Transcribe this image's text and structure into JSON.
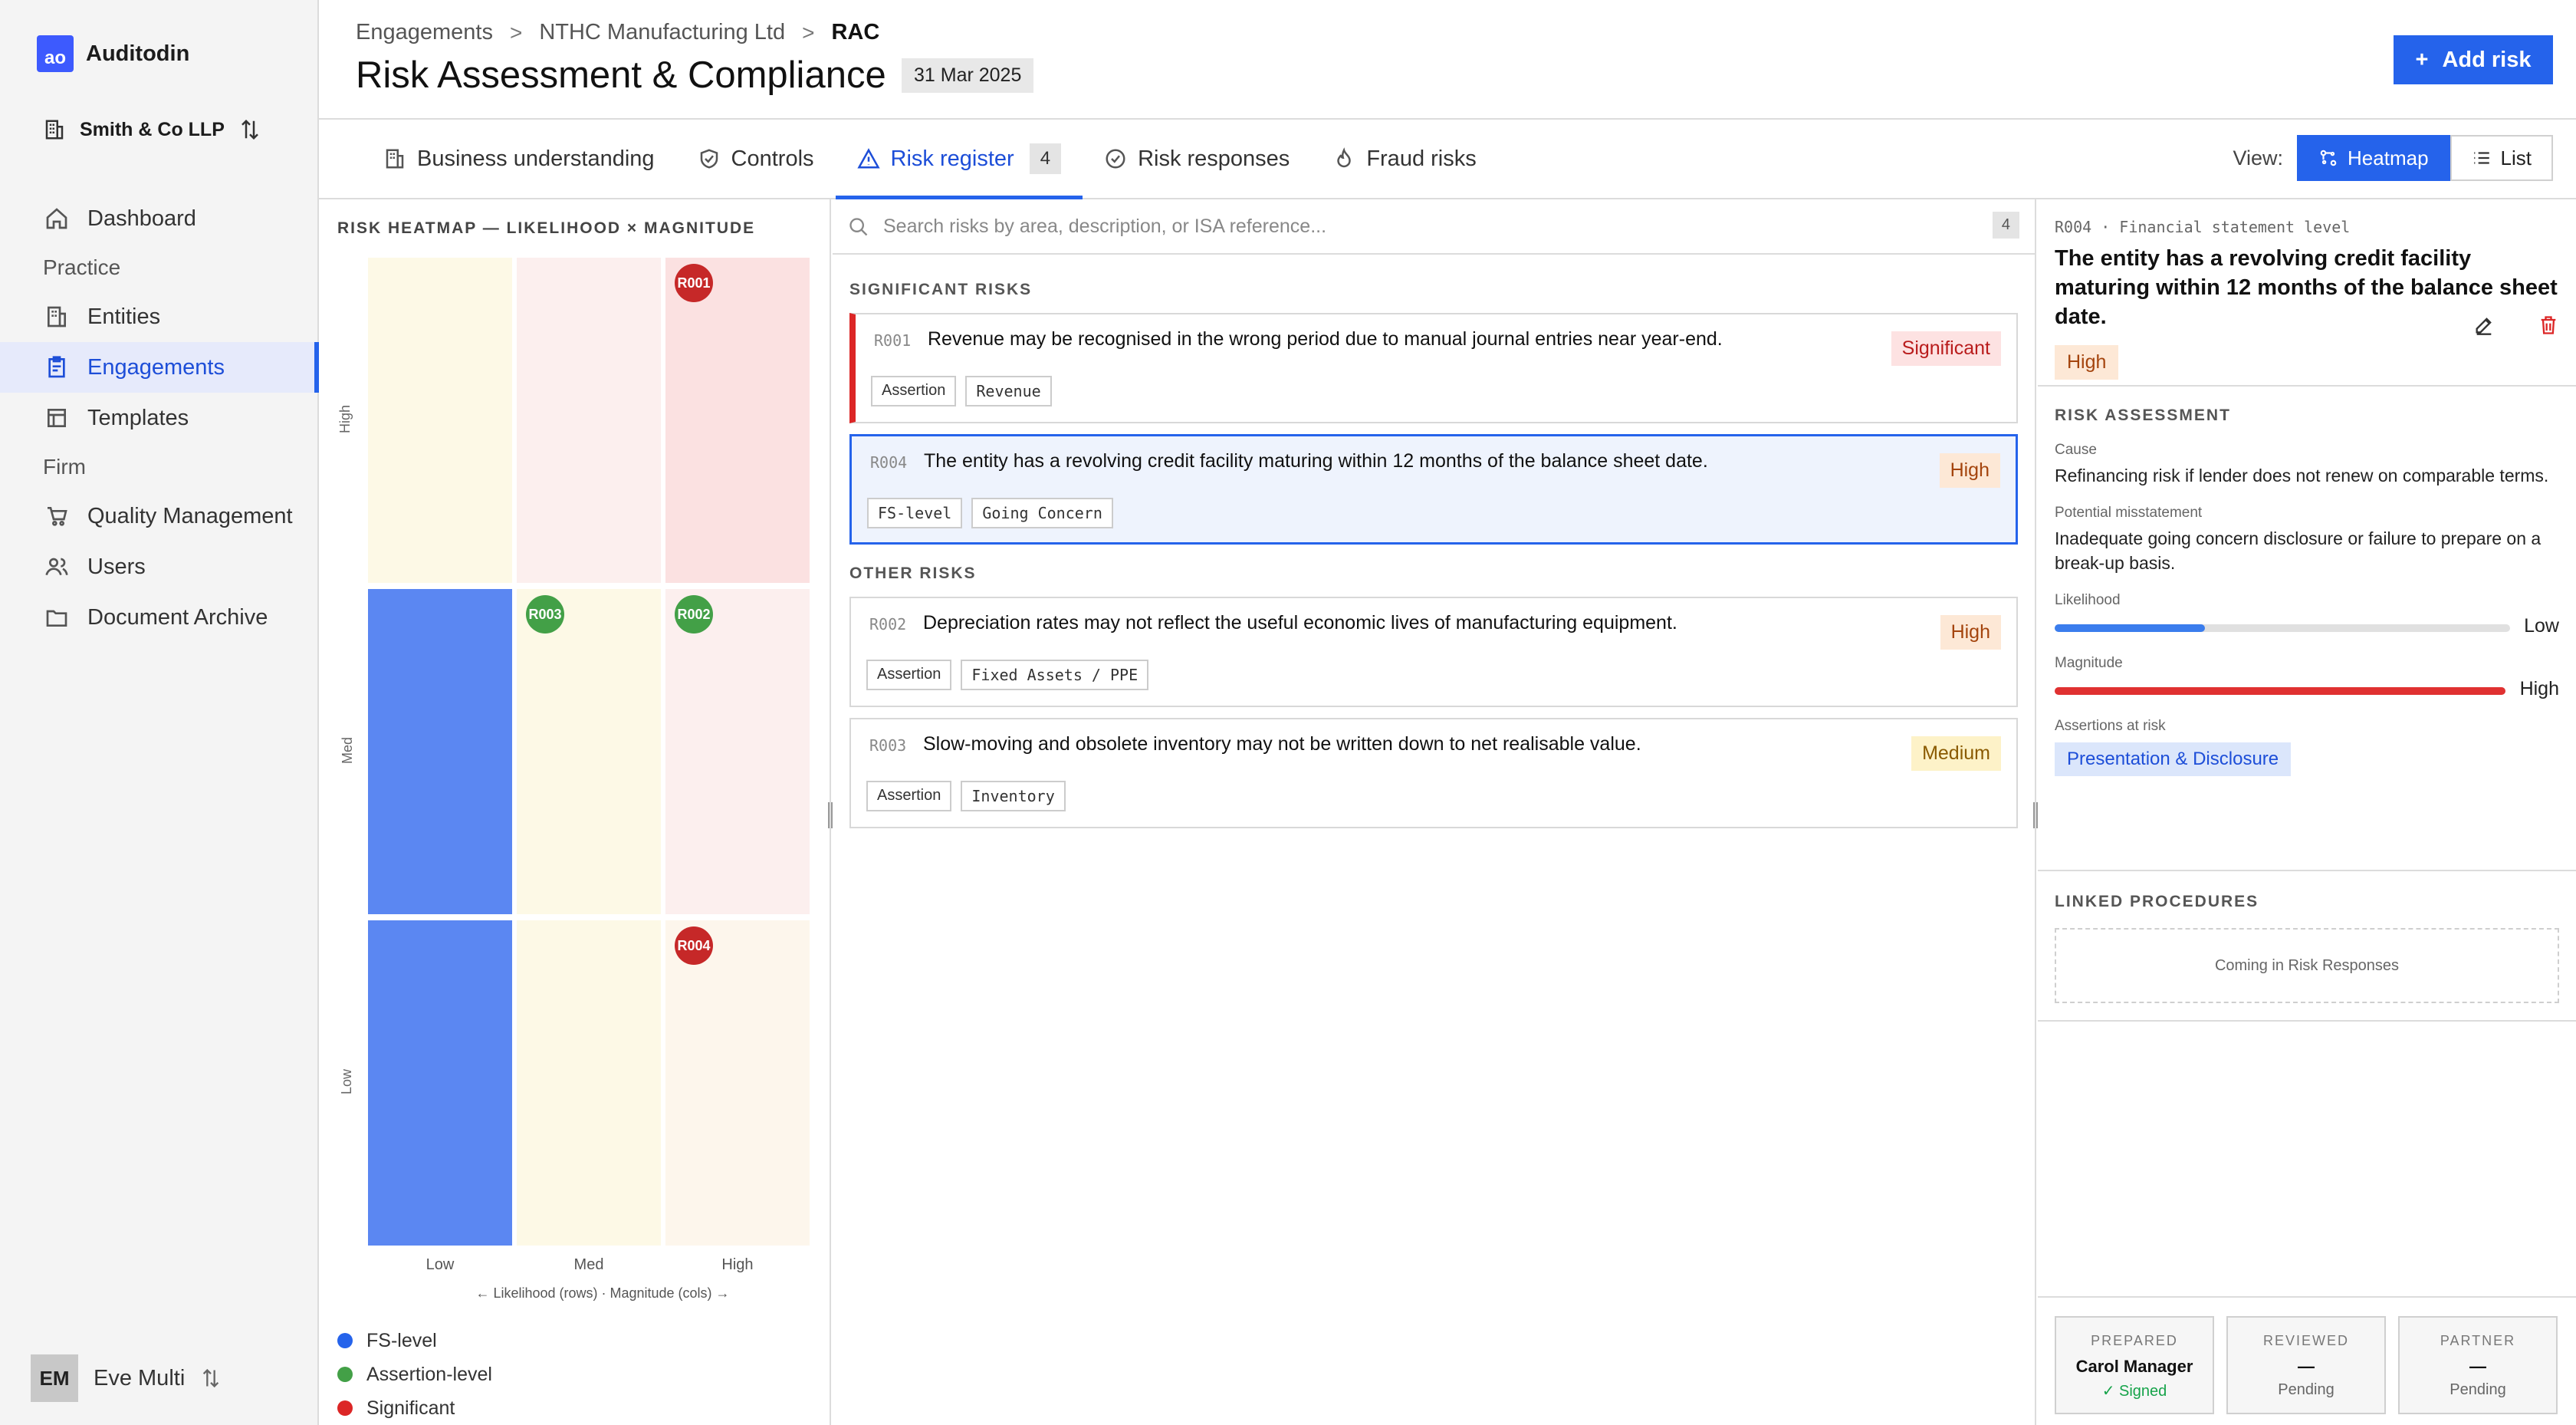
{
  "brand": {
    "name": "Auditodin",
    "logo": "ao"
  },
  "org": {
    "name": "Smith & Co LLP"
  },
  "nav": {
    "dashboard": "Dashboard",
    "practice": "Practice",
    "entities": "Entities",
    "engagements": "Engagements",
    "templates": "Templates",
    "firm": "Firm",
    "quality": "Quality Management",
    "users": "Users",
    "archive": "Document Archive"
  },
  "user": {
    "initials": "EM",
    "name": "Eve Multi"
  },
  "breadcrumb": {
    "c1": "Engagements",
    "c2": "NTHC Manufacturing Ltd",
    "c3": "RAC",
    "sep": ">"
  },
  "page": {
    "title": "Risk Assessment & Compliance",
    "date": "31 Mar 2025",
    "add_label": "Add risk"
  },
  "tabs": {
    "business": "Business understanding",
    "controls": "Controls",
    "register": "Risk register",
    "register_count": "4",
    "responses": "Risk responses",
    "fraud": "Fraud risks"
  },
  "view": {
    "label": "View:",
    "heatmap": "Heatmap",
    "list": "List"
  },
  "heatmap": {
    "title": "RISK HEATMAP — LIKELIHOOD × MAGNITUDE",
    "rows": [
      "High",
      "Med",
      "Low"
    ],
    "cols": [
      "Low",
      "Med",
      "High"
    ],
    "caption": "← Likelihood (rows) · Magnitude (cols) →",
    "markers": [
      {
        "id": "R001",
        "row": "High",
        "col": "High",
        "type": "Significant"
      },
      {
        "id": "R003",
        "row": "Med",
        "col": "Med",
        "type": "Assertion-level"
      },
      {
        "id": "R002",
        "row": "Med",
        "col": "High",
        "type": "Assertion-level"
      },
      {
        "id": "R004",
        "row": "Low",
        "col": "High",
        "type": "Significant"
      }
    ],
    "legend": [
      {
        "label": "FS-level",
        "color": "#2563eb"
      },
      {
        "label": "Assertion-level",
        "color": "#43a047"
      },
      {
        "label": "Significant",
        "color": "#dc2626"
      }
    ]
  },
  "search": {
    "placeholder": "Search risks by area, description, or ISA reference...",
    "count": "4"
  },
  "sections": {
    "significant": "SIGNIFICANT RISKS",
    "other": "OTHER RISKS"
  },
  "risks": [
    {
      "id": "R001",
      "desc": "Revenue may be recognised in the wrong period due to manual journal entries near year-end.",
      "badge": "Significant",
      "tags": [
        "Assertion",
        "Revenue"
      ]
    },
    {
      "id": "R004",
      "desc": "The entity has a revolving credit facility maturing within 12 months of the balance sheet date.",
      "badge": "High",
      "tags": [
        "FS-level",
        "Going Concern"
      ]
    },
    {
      "id": "R002",
      "desc": "Depreciation rates may not reflect the useful economic lives of manufacturing equipment.",
      "badge": "High",
      "tags": [
        "Assertion",
        "Fixed Assets / PPE"
      ]
    },
    {
      "id": "R003",
      "desc": "Slow-moving and obsolete inventory may not be written down to net realisable value.",
      "badge": "Medium",
      "tags": [
        "Assertion",
        "Inventory"
      ]
    }
  ],
  "detail": {
    "id_line": "R004 · Financial statement level",
    "title": "The entity has a revolving credit facility maturing within 12 months of the balance sheet date.",
    "badge": "High",
    "assessment": "RISK ASSESSMENT",
    "cause_label": "Cause",
    "cause": "Refinancing risk if lender does not renew on comparable terms.",
    "pm_label": "Potential misstatement",
    "pm": "Inadequate going concern disclosure or failure to prepare on a break-up basis.",
    "likelihood_label": "Likelihood",
    "likelihood": "Low",
    "likelihood_level": 0.33,
    "magnitude_label": "Magnitude",
    "magnitude": "High",
    "magnitude_level": 1.0,
    "assertions_label": "Assertions at risk",
    "assertion": "Presentation & Disclosure",
    "linked": "LINKED PROCEDURES",
    "linked_empty": "Coming in Risk Responses"
  },
  "signoff": [
    {
      "role": "PREPARED",
      "name": "Carol Manager",
      "status": "✓ Signed"
    },
    {
      "role": "REVIEWED",
      "name": "—",
      "status": "Pending"
    },
    {
      "role": "PARTNER",
      "name": "—",
      "status": "Pending"
    }
  ],
  "colors": {
    "accent": "#2563eb",
    "significant": "#dc2626",
    "assertion": "#43a047"
  }
}
